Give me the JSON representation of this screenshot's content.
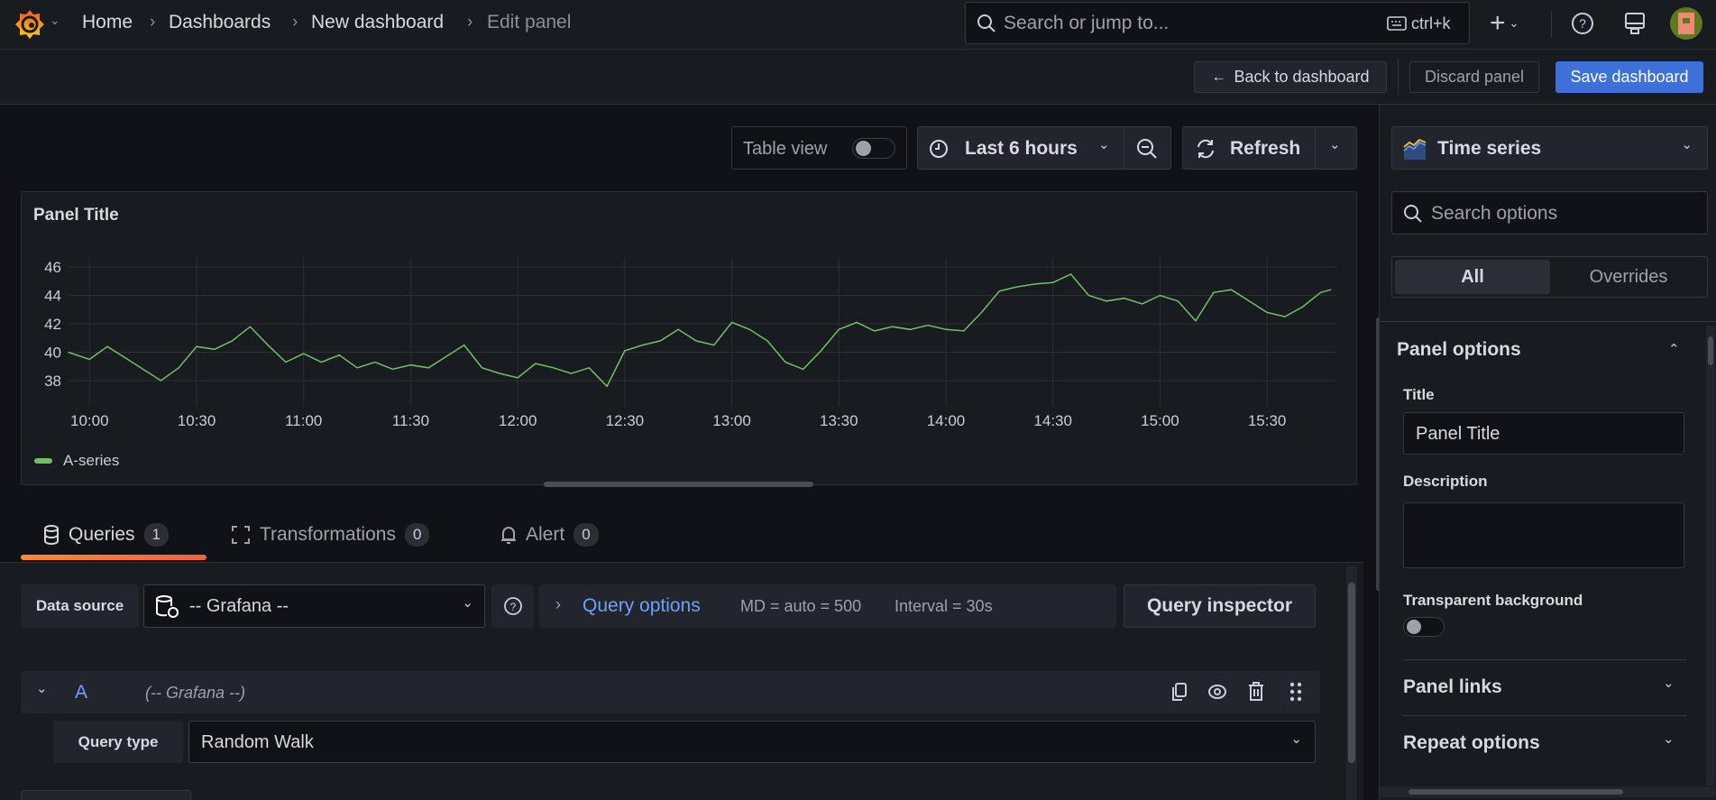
{
  "topbar": {
    "breadcrumbs": [
      "Home",
      "Dashboards",
      "New dashboard",
      "Edit panel"
    ],
    "search_placeholder": "Search or jump to...",
    "shortcut": "ctrl+k"
  },
  "actions": {
    "back": "Back to dashboard",
    "discard": "Discard panel",
    "save": "Save dashboard"
  },
  "toolbar": {
    "table_view": "Table view",
    "time_range": "Last 6 hours",
    "refresh": "Refresh"
  },
  "panel": {
    "title": "Panel Title"
  },
  "chart_data": {
    "type": "line",
    "title": "Panel Title",
    "xlabel": "",
    "ylabel": "",
    "ylim": [
      36.5,
      47
    ],
    "yticks": [
      38,
      40,
      42,
      44,
      46
    ],
    "xticks": [
      "10:00",
      "10:30",
      "11:00",
      "11:30",
      "12:00",
      "12:30",
      "13:00",
      "13:30",
      "14:00",
      "14:30",
      "15:00",
      "15:30"
    ],
    "grid": true,
    "legend": "bottom-left",
    "series": [
      {
        "name": "A-series",
        "color": "#73bf69",
        "x": [
          "09:54",
          "10:00",
          "10:05",
          "10:10",
          "10:15",
          "10:20",
          "10:25",
          "10:30",
          "10:35",
          "10:40",
          "10:45",
          "10:50",
          "10:55",
          "11:00",
          "11:05",
          "11:10",
          "11:15",
          "11:20",
          "11:25",
          "11:30",
          "11:35",
          "11:40",
          "11:45",
          "11:50",
          "11:55",
          "12:00",
          "12:05",
          "12:10",
          "12:15",
          "12:20",
          "12:25",
          "12:30",
          "12:35",
          "12:40",
          "12:45",
          "12:50",
          "12:55",
          "13:00",
          "13:05",
          "13:10",
          "13:15",
          "13:20",
          "13:25",
          "13:30",
          "13:35",
          "13:40",
          "13:45",
          "13:50",
          "13:55",
          "14:00",
          "14:05",
          "14:10",
          "14:15",
          "14:20",
          "14:25",
          "14:30",
          "14:35",
          "14:40",
          "14:45",
          "14:50",
          "14:55",
          "15:00",
          "15:05",
          "15:10",
          "15:15",
          "15:20",
          "15:25",
          "15:30",
          "15:35",
          "15:40",
          "15:45",
          "15:48"
        ],
        "values": [
          40.0,
          39.5,
          40.4,
          39.6,
          38.8,
          38.0,
          38.9,
          40.4,
          40.2,
          40.8,
          41.8,
          40.5,
          39.3,
          39.9,
          39.3,
          39.8,
          38.9,
          39.3,
          38.8,
          39.1,
          38.9,
          39.7,
          40.5,
          38.9,
          38.5,
          38.2,
          39.2,
          38.9,
          38.5,
          38.9,
          37.6,
          40.1,
          40.5,
          40.8,
          41.6,
          40.8,
          40.5,
          42.1,
          41.6,
          40.8,
          39.3,
          38.8,
          40.1,
          41.6,
          42.1,
          41.5,
          41.8,
          41.6,
          41.9,
          41.6,
          41.5,
          42.8,
          44.3,
          44.6,
          44.8,
          44.9,
          45.5,
          44.0,
          43.6,
          43.8,
          43.4,
          44.0,
          43.6,
          42.2,
          44.2,
          44.4,
          43.6,
          42.8,
          42.5,
          43.2,
          44.2,
          44.4
        ]
      }
    ]
  },
  "tabs": [
    {
      "label": "Queries",
      "count": "1"
    },
    {
      "label": "Transformations",
      "count": "0"
    },
    {
      "label": "Alert",
      "count": "0"
    }
  ],
  "query": {
    "data_source_label": "Data source",
    "data_source": "-- Grafana --",
    "query_options": "Query options",
    "md": "MD = auto = 500",
    "interval": "Interval = 30s",
    "inspector": "Query inspector",
    "ref_id": "A",
    "ref_source": "(-- Grafana --)",
    "query_type_label": "Query type",
    "query_type": "Random Walk"
  },
  "options": {
    "visualization": "Time series",
    "search_placeholder": "Search options",
    "tab_all": "All",
    "tab_overrides": "Overrides",
    "panel_options": "Panel options",
    "title_label": "Title",
    "title_value": "Panel Title",
    "description_label": "Description",
    "transparent_label": "Transparent background",
    "panel_links": "Panel links",
    "repeat_options": "Repeat options"
  },
  "colors": {
    "accent": "#3d71d9",
    "series": "#73bf69",
    "link": "#6e9fff",
    "tab_underline": "#f55f3e"
  }
}
